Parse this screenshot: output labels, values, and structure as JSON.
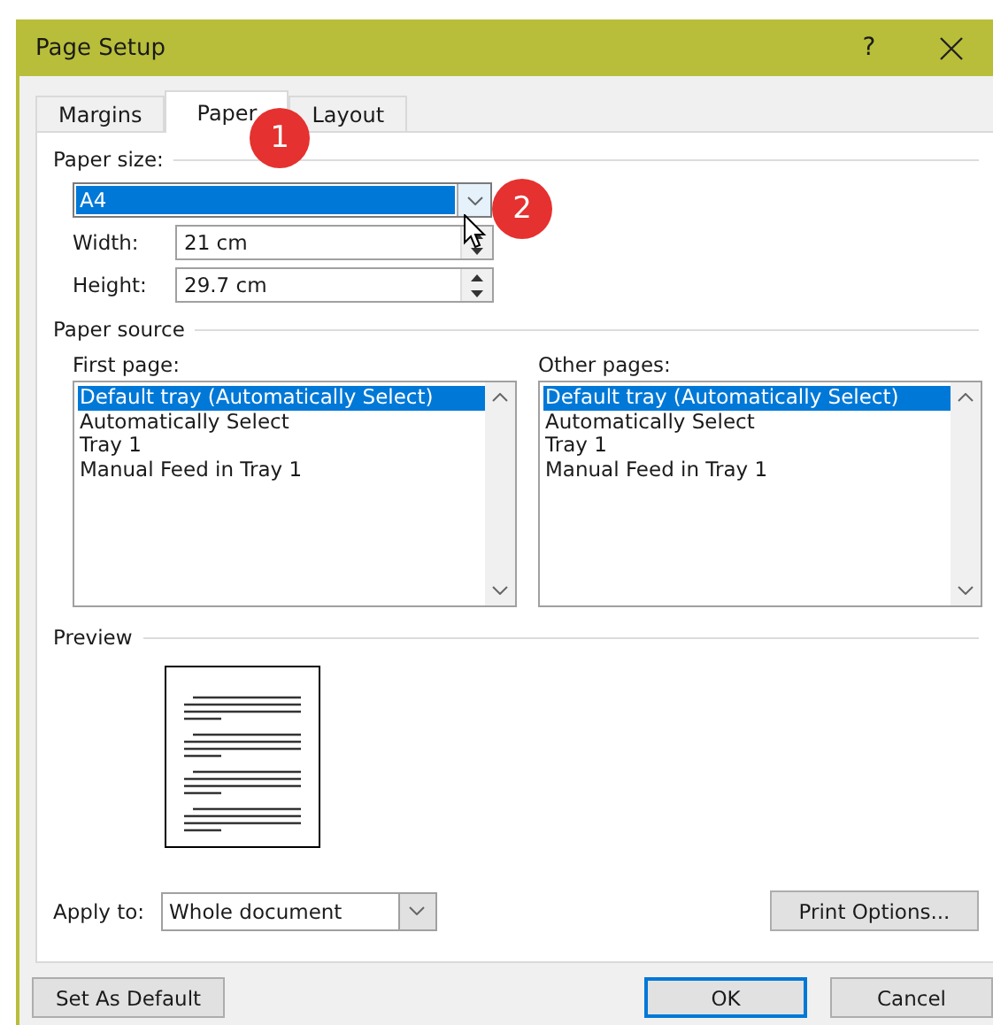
{
  "window": {
    "title": "Page Setup",
    "help": "?"
  },
  "tabs": [
    {
      "label": "Margins",
      "selected": false
    },
    {
      "label": "Paper",
      "selected": true
    },
    {
      "label": "Layout",
      "selected": false
    }
  ],
  "paper_size": {
    "label": "Paper size:",
    "value": "A4",
    "width_label": "Width:",
    "width": "21 cm",
    "height_label": "Height:",
    "height": "29.7 cm"
  },
  "paper_source": {
    "label": "Paper source",
    "lists": [
      {
        "label": "First page:",
        "items": [
          {
            "text": "Default tray (Automatically Select)",
            "selected": true
          },
          {
            "text": "Automatically Select",
            "selected": false
          },
          {
            "text": "Tray 1",
            "selected": false
          },
          {
            "text": "Manual Feed in Tray 1",
            "selected": false
          }
        ]
      },
      {
        "label": "Other pages:",
        "items": [
          {
            "text": "Default tray (Automatically Select)",
            "selected": true
          },
          {
            "text": "Automatically Select",
            "selected": false
          },
          {
            "text": "Tray 1",
            "selected": false
          },
          {
            "text": "Manual Feed in Tray 1",
            "selected": false
          }
        ]
      }
    ]
  },
  "preview": {
    "label": "Preview"
  },
  "apply_to": {
    "label": "Apply to:",
    "value": "Whole document"
  },
  "print_options": "Print Options...",
  "buttons": [
    {
      "label": "Set As Default",
      "default": false
    },
    {
      "label": "OK",
      "default": true
    },
    {
      "label": "Cancel",
      "default": false
    }
  ],
  "callouts": [
    "1",
    "2"
  ]
}
